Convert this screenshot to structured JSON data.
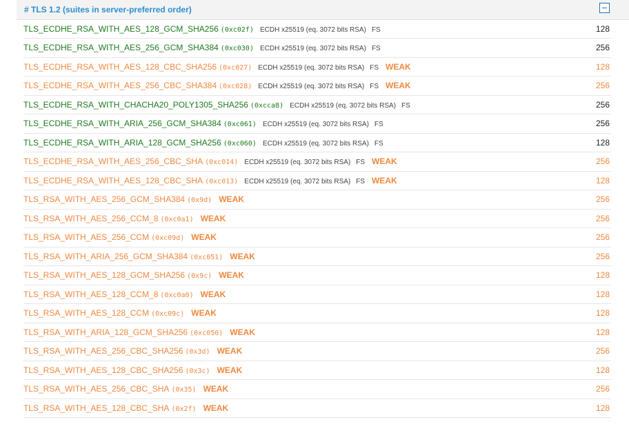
{
  "section": {
    "title": "# TLS 1.2 (suites in server-preferred order)",
    "collapse_icon": "collapse-minus-icon"
  },
  "colors": {
    "title_blue": "#2a8fd0",
    "strong_green": "#1d7a1d",
    "weak_orange": "#f0883e"
  },
  "rows": [
    {
      "suite": "TLS_ECDHE_RSA_WITH_AES_128_GCM_SHA256",
      "code": "(0xc02f)",
      "kex": "ECDH x25519 (eq. 3072 bits RSA)",
      "fs": "FS",
      "weak": "",
      "bits": "128",
      "status": "good"
    },
    {
      "suite": "TLS_ECDHE_RSA_WITH_AES_256_GCM_SHA384",
      "code": "(0xc030)",
      "kex": "ECDH x25519 (eq. 3072 bits RSA)",
      "fs": "FS",
      "weak": "",
      "bits": "256",
      "status": "good"
    },
    {
      "suite": "TLS_ECDHE_RSA_WITH_AES_128_CBC_SHA256",
      "code": "(0xc027)",
      "kex": "ECDH x25519 (eq. 3072 bits RSA)",
      "fs": "FS",
      "weak": "WEAK",
      "bits": "128",
      "status": "bad"
    },
    {
      "suite": "TLS_ECDHE_RSA_WITH_AES_256_CBC_SHA384",
      "code": "(0xc028)",
      "kex": "ECDH x25519 (eq. 3072 bits RSA)",
      "fs": "FS",
      "weak": "WEAK",
      "bits": "256",
      "status": "bad"
    },
    {
      "suite": "TLS_ECDHE_RSA_WITH_CHACHA20_POLY1305_SHA256",
      "code": "(0xcca8)",
      "kex": "ECDH x25519 (eq. 3072 bits RSA)",
      "fs": "FS",
      "weak": "",
      "bits": "256",
      "status": "good"
    },
    {
      "suite": "TLS_ECDHE_RSA_WITH_ARIA_256_GCM_SHA384",
      "code": "(0xc061)",
      "kex": "ECDH x25519 (eq. 3072 bits RSA)",
      "fs": "FS",
      "weak": "",
      "bits": "256",
      "status": "good"
    },
    {
      "suite": "TLS_ECDHE_RSA_WITH_ARIA_128_GCM_SHA256",
      "code": "(0xc060)",
      "kex": "ECDH x25519 (eq. 3072 bits RSA)",
      "fs": "FS",
      "weak": "",
      "bits": "128",
      "status": "good"
    },
    {
      "suite": "TLS_ECDHE_RSA_WITH_AES_256_CBC_SHA",
      "code": "(0xc014)",
      "kex": "ECDH x25519 (eq. 3072 bits RSA)",
      "fs": "FS",
      "weak": "WEAK",
      "bits": "256",
      "status": "bad"
    },
    {
      "suite": "TLS_ECDHE_RSA_WITH_AES_128_CBC_SHA",
      "code": "(0xc013)",
      "kex": "ECDH x25519 (eq. 3072 bits RSA)",
      "fs": "FS",
      "weak": "WEAK",
      "bits": "128",
      "status": "bad"
    },
    {
      "suite": "TLS_RSA_WITH_AES_256_GCM_SHA384",
      "code": "(0x9d)",
      "kex": "",
      "fs": "",
      "weak": "WEAK",
      "bits": "256",
      "status": "bad"
    },
    {
      "suite": "TLS_RSA_WITH_AES_256_CCM_8",
      "code": "(0xc0a1)",
      "kex": "",
      "fs": "",
      "weak": "WEAK",
      "bits": "256",
      "status": "bad"
    },
    {
      "suite": "TLS_RSA_WITH_AES_256_CCM",
      "code": "(0xc09d)",
      "kex": "",
      "fs": "",
      "weak": "WEAK",
      "bits": "256",
      "status": "bad"
    },
    {
      "suite": "TLS_RSA_WITH_ARIA_256_GCM_SHA384",
      "code": "(0xc051)",
      "kex": "",
      "fs": "",
      "weak": "WEAK",
      "bits": "256",
      "status": "bad"
    },
    {
      "suite": "TLS_RSA_WITH_AES_128_GCM_SHA256",
      "code": "(0x9c)",
      "kex": "",
      "fs": "",
      "weak": "WEAK",
      "bits": "128",
      "status": "bad"
    },
    {
      "suite": "TLS_RSA_WITH_AES_128_CCM_8",
      "code": "(0xc0a0)",
      "kex": "",
      "fs": "",
      "weak": "WEAK",
      "bits": "128",
      "status": "bad"
    },
    {
      "suite": "TLS_RSA_WITH_AES_128_CCM",
      "code": "(0xc09c)",
      "kex": "",
      "fs": "",
      "weak": "WEAK",
      "bits": "128",
      "status": "bad"
    },
    {
      "suite": "TLS_RSA_WITH_ARIA_128_GCM_SHA256",
      "code": "(0xc050)",
      "kex": "",
      "fs": "",
      "weak": "WEAK",
      "bits": "128",
      "status": "bad"
    },
    {
      "suite": "TLS_RSA_WITH_AES_256_CBC_SHA256",
      "code": "(0x3d)",
      "kex": "",
      "fs": "",
      "weak": "WEAK",
      "bits": "256",
      "status": "bad"
    },
    {
      "suite": "TLS_RSA_WITH_AES_128_CBC_SHA256",
      "code": "(0x3c)",
      "kex": "",
      "fs": "",
      "weak": "WEAK",
      "bits": "128",
      "status": "bad"
    },
    {
      "suite": "TLS_RSA_WITH_AES_256_CBC_SHA",
      "code": "(0x35)",
      "kex": "",
      "fs": "",
      "weak": "WEAK",
      "bits": "256",
      "status": "bad"
    },
    {
      "suite": "TLS_RSA_WITH_AES_128_CBC_SHA",
      "code": "(0x2f)",
      "kex": "",
      "fs": "",
      "weak": "WEAK",
      "bits": "128",
      "status": "bad"
    }
  ]
}
